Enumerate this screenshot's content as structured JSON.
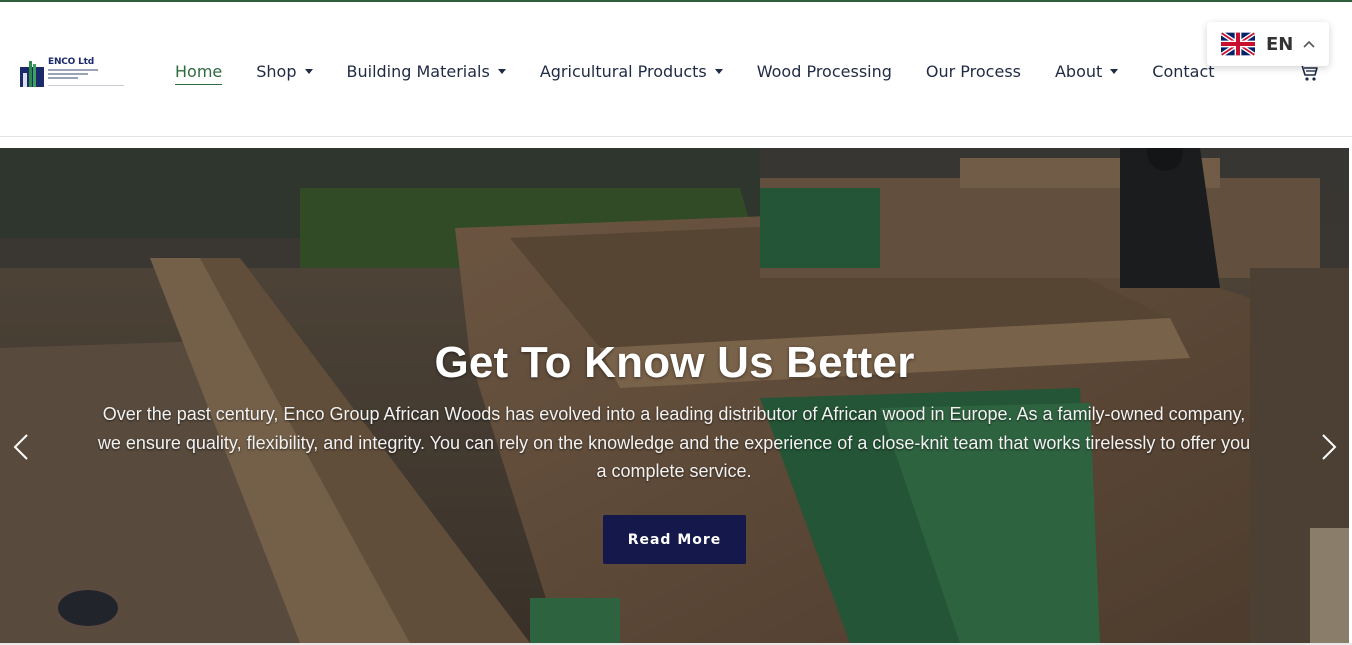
{
  "brand": {
    "logo_text": "ENCO Ltd",
    "navy": "#1b2a6b",
    "green": "#2d6a3e"
  },
  "nav": {
    "items": [
      {
        "label": "Home",
        "active": true,
        "dropdown": false
      },
      {
        "label": "Shop",
        "active": false,
        "dropdown": true
      },
      {
        "label": "Building Materials",
        "active": false,
        "dropdown": true
      },
      {
        "label": "Agricultural Products",
        "active": false,
        "dropdown": true
      },
      {
        "label": "Wood Processing",
        "active": false,
        "dropdown": false
      },
      {
        "label": "Our Process",
        "active": false,
        "dropdown": false
      },
      {
        "label": "About",
        "active": false,
        "dropdown": true
      },
      {
        "label": "Contact",
        "active": false,
        "dropdown": false
      }
    ],
    "cart_icon": "cart-icon"
  },
  "language": {
    "code": "EN",
    "flag": "uk-flag-icon"
  },
  "hero": {
    "title": "Get To Know Us Better",
    "text": "Over the past century, Enco Group African Woods has evolved into a leading distributor of African wood in Europe. As a family-owned company, we ensure quality, flexibility, and integrity. You can rely on the knowledge and the experience of a close-knit team that works tirelessly to offer you a complete service.",
    "button_label": "Read More",
    "button_color": "#14184a"
  }
}
